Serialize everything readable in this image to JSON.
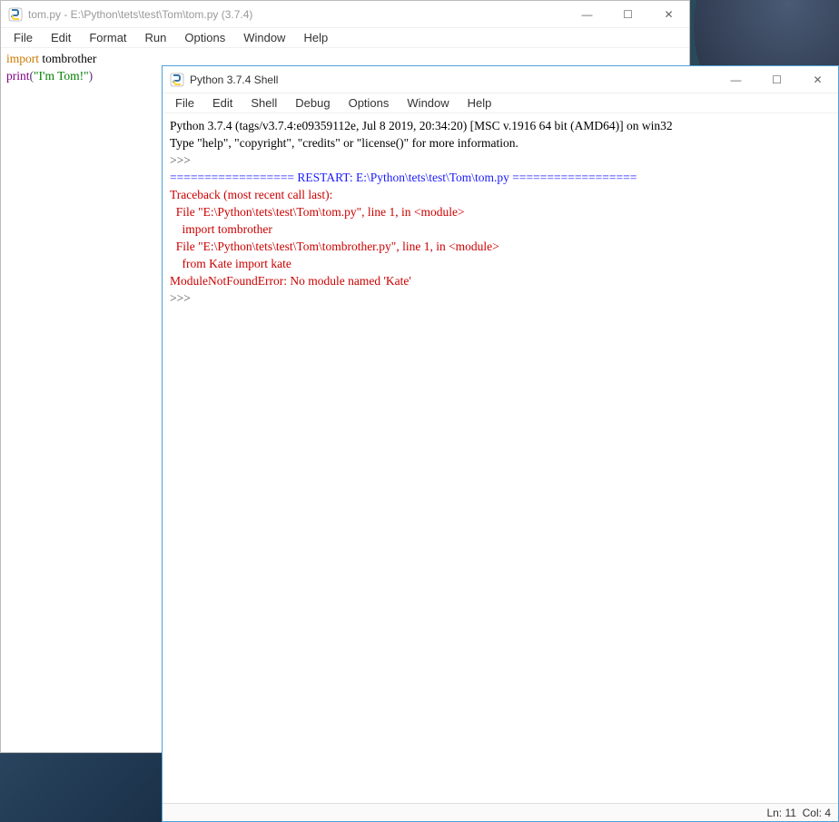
{
  "editor_window": {
    "title": "tom.py - E:\\Python\\tets\\test\\Tom\\tom.py (3.7.4)",
    "menus": [
      "File",
      "Edit",
      "Format",
      "Run",
      "Options",
      "Window",
      "Help"
    ],
    "code": {
      "line1_kw": "import",
      "line1_rest": " tombrother",
      "line2_func": "print",
      "line2_open": "(",
      "line2_str": "\"I'm Tom!\"",
      "line2_close": ")"
    }
  },
  "shell_window": {
    "title": "Python 3.7.4 Shell",
    "menus": [
      "File",
      "Edit",
      "Shell",
      "Debug",
      "Options",
      "Window",
      "Help"
    ],
    "banner_line1": "Python 3.7.4 (tags/v3.7.4:e09359112e, Jul  8 2019, 20:34:20) [MSC v.1916 64 bit (AMD64)] on win32",
    "banner_line2": "Type \"help\", \"copyright\", \"credits\" or \"license()\" for more information.",
    "prompt1": ">>> ",
    "restart_line": "================== RESTART: E:\\Python\\tets\\test\\Tom\\tom.py ==================",
    "tb1": "Traceback (most recent call last):",
    "tb2": "  File \"E:\\Python\\tets\\test\\Tom\\tom.py\", line 1, in <module>",
    "tb3": "    import tombrother",
    "tb4": "  File \"E:\\Python\\tets\\test\\Tom\\tombrother.py\", line 1, in <module>",
    "tb5": "    from Kate import kate",
    "tb6": "ModuleNotFoundError: No module named 'Kate'",
    "prompt2": ">>> ",
    "status": {
      "ln_label": "Ln:",
      "ln_val": "11",
      "col_label": "Col:",
      "col_val": "4"
    }
  },
  "winctrl": {
    "min": "—",
    "max": "☐",
    "close": "✕"
  }
}
